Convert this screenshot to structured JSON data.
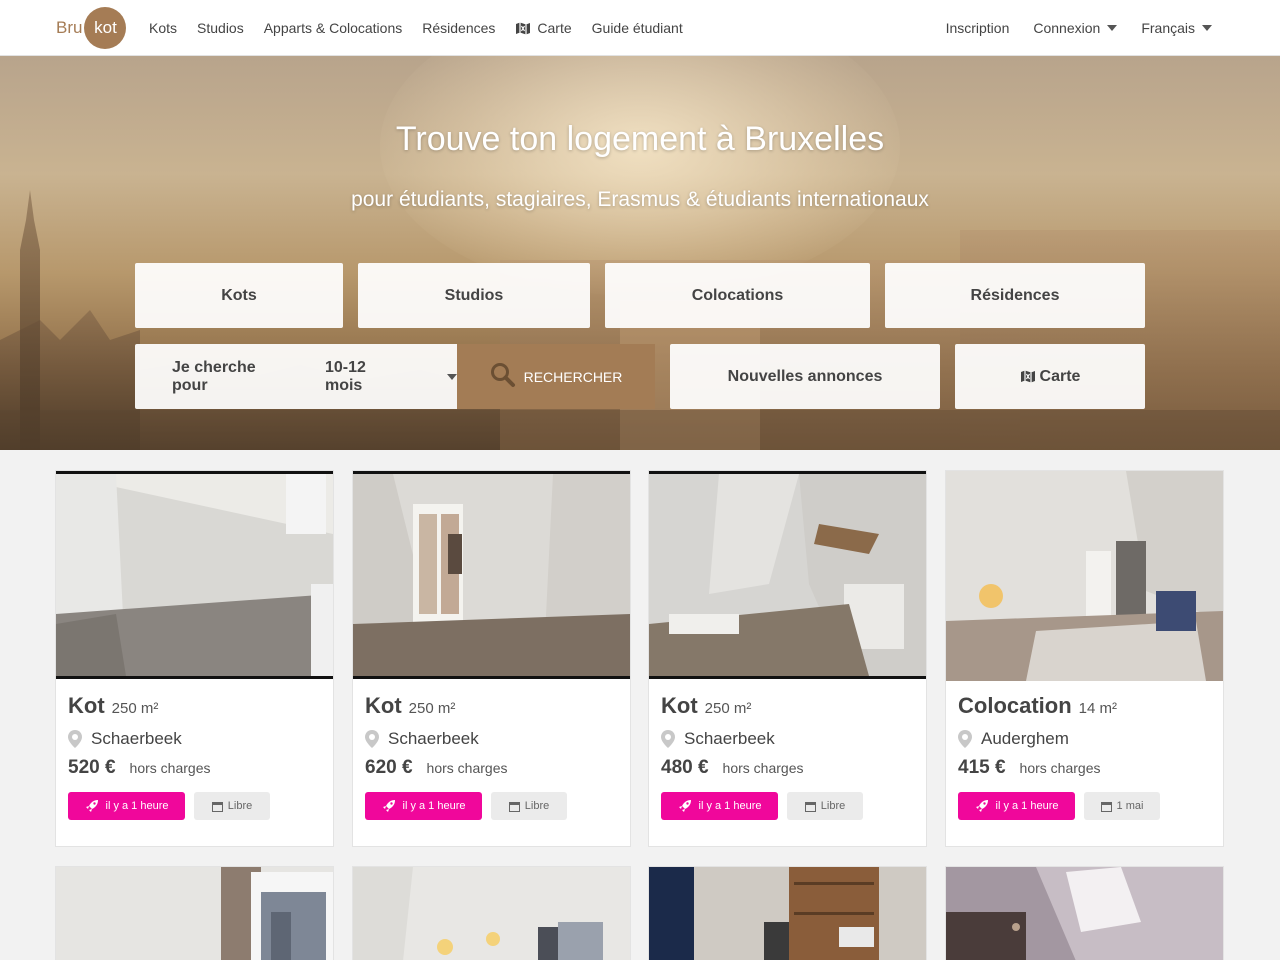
{
  "brand": {
    "logo_left": "Bru",
    "logo_right": "kot"
  },
  "nav": {
    "left": [
      "Kots",
      "Studios",
      "Apparts & Colocations",
      "Résidences",
      "Carte",
      "Guide étudiant"
    ],
    "right": {
      "signup": "Inscription",
      "login": "Connexion",
      "language": "Français"
    }
  },
  "hero": {
    "title": "Trouve ton logement à Bruxelles",
    "subtitle": "pour étudiants, stagiaires, Erasmus & étudiants internationaux",
    "categories": [
      "Kots",
      "Studios",
      "Colocations",
      "Résidences"
    ],
    "search": {
      "label": "Je cherche pour",
      "duration": "10-12 mois",
      "button": "RECHERCHER"
    },
    "new_listings": "Nouvelles annonces",
    "map": "Carte"
  },
  "listings": [
    {
      "type": "Kot",
      "size": "250 m²",
      "location": "Schaerbeek",
      "price": "520 €",
      "price_note": "hors charges",
      "posted": "il y a 1 heure",
      "availability": "Libre"
    },
    {
      "type": "Kot",
      "size": "250 m²",
      "location": "Schaerbeek",
      "price": "620 €",
      "price_note": "hors charges",
      "posted": "il y a 1 heure",
      "availability": "Libre"
    },
    {
      "type": "Kot",
      "size": "250 m²",
      "location": "Schaerbeek",
      "price": "480 €",
      "price_note": "hors charges",
      "posted": "il y a 1 heure",
      "availability": "Libre"
    },
    {
      "type": "Colocation",
      "size": "14 m²",
      "location": "Auderghem",
      "price": "415 €",
      "price_note": "hors charges",
      "posted": "il y a 1 heure",
      "availability": "1 mai"
    }
  ],
  "colors": {
    "brand": "#a57c55",
    "new_badge": "#f0079b"
  }
}
